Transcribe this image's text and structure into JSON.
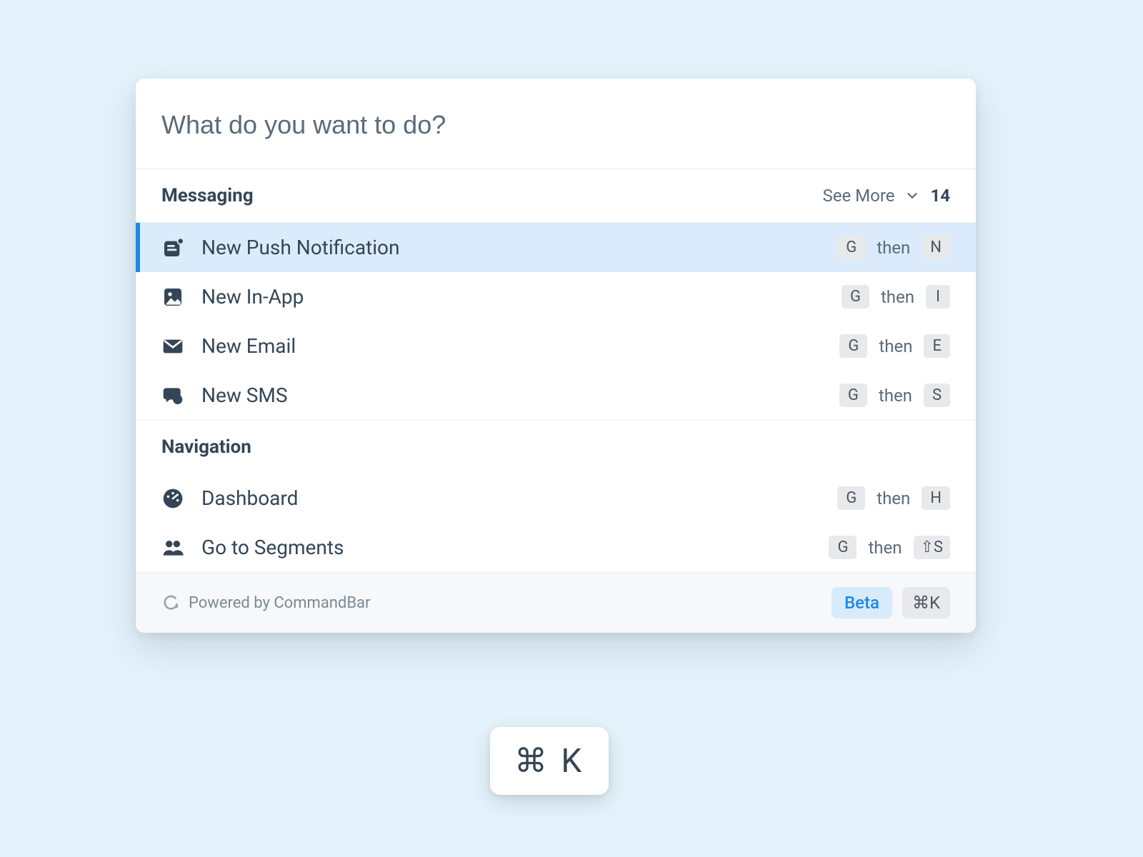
{
  "search": {
    "placeholder": "What do you want to do?",
    "value": ""
  },
  "sections": {
    "messaging": {
      "title": "Messaging",
      "see_more": "See More",
      "count": "14",
      "items": [
        {
          "label": "New Push Notification",
          "key1": "G",
          "then": "then",
          "key2": "N"
        },
        {
          "label": "New In-App",
          "key1": "G",
          "then": "then",
          "key2": "I"
        },
        {
          "label": "New Email",
          "key1": "G",
          "then": "then",
          "key2": "E"
        },
        {
          "label": "New SMS",
          "key1": "G",
          "then": "then",
          "key2": "S"
        }
      ]
    },
    "navigation": {
      "title": "Navigation",
      "items": [
        {
          "label": "Dashboard",
          "key1": "G",
          "then": "then",
          "key2": "H"
        },
        {
          "label": "Go to Segments",
          "key1": "G",
          "then": "then",
          "key2": "⇧S"
        }
      ]
    }
  },
  "footer": {
    "powered_by": "Powered by CommandBar",
    "beta": "Beta",
    "shortcut": "⌘K"
  },
  "floating_shortcut": "⌘ K"
}
